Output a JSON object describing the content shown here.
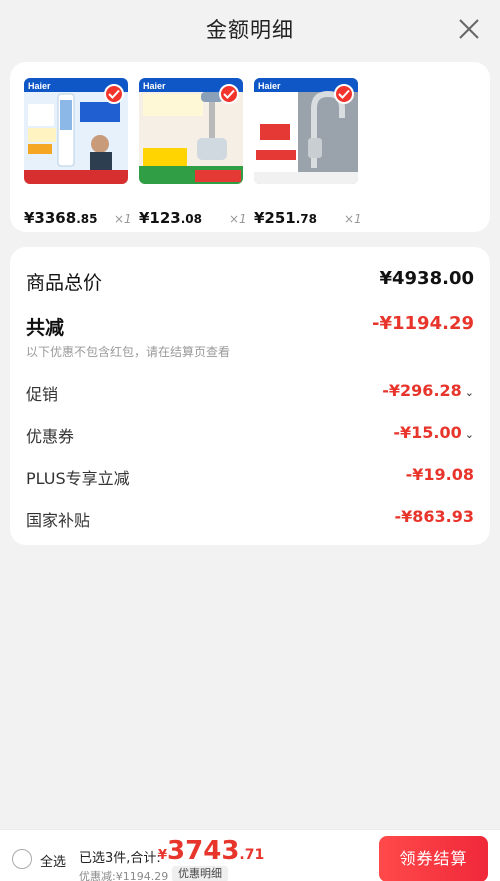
{
  "header": {
    "title": "金额明细"
  },
  "products": [
    {
      "brand": "Haier",
      "price_int": "¥3368",
      "price_dec": ".85",
      "qty": "×1",
      "selected": true
    },
    {
      "brand": "Haier",
      "price_int": "¥123",
      "price_dec": ".08",
      "qty": "×1",
      "selected": true
    },
    {
      "brand": "Haier",
      "price_int": "¥251",
      "price_dec": ".78",
      "qty": "×1",
      "selected": true
    }
  ],
  "summary": {
    "total_label": "商品总价",
    "total_value": "¥4938.00",
    "reduce_label": "共减",
    "reduce_value": "-¥1194.29",
    "note": "以下优惠不包含红包，请在结算页查看",
    "promo_label": "促销",
    "promo_value": "-¥296.28",
    "coupon_label": "优惠券",
    "coupon_value": "-¥15.00",
    "plus_label": "PLUS专享立减",
    "plus_value": "-¥19.08",
    "subsidy_label": "国家补贴",
    "subsidy_value": "-¥863.93"
  },
  "bottom": {
    "select_all": "全选",
    "selected_count": "已选3件,合计:",
    "total_currency": "¥",
    "total_int": "3743",
    "total_dec": ".71",
    "discount_line": "优惠减:¥1194.29",
    "detail_tag": "优惠明细",
    "checkout": "领券结算"
  },
  "colors": {
    "accent_red": "#e8352c",
    "checkout_gradient_start": "#ff4a4a",
    "checkout_gradient_end": "#f0283a"
  }
}
